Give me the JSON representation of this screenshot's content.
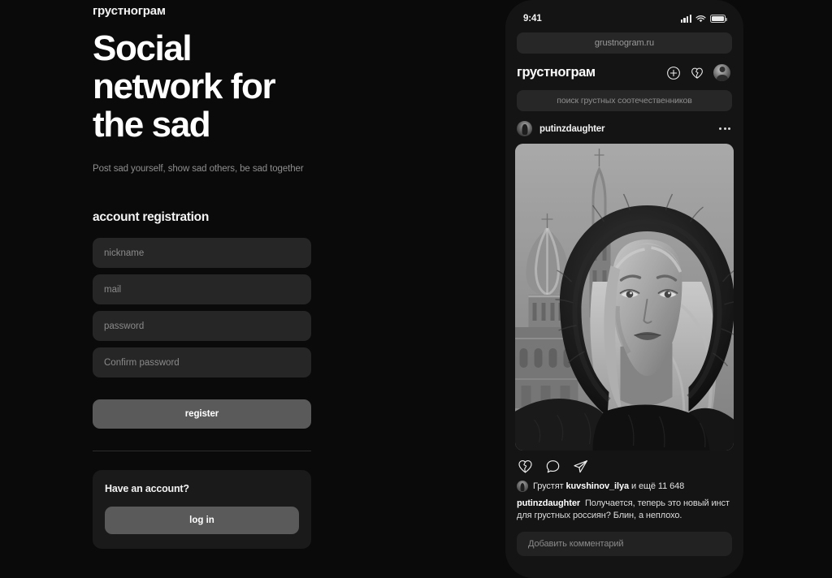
{
  "colors": {
    "page_bg": "#0a0a0a",
    "field_bg": "#262626",
    "button_bg": "#5a5a5a",
    "card_bg": "#1a1a1a",
    "phone_bg": "#141414",
    "text_primary": "#ffffff",
    "text_muted": "#8e8e8e"
  },
  "landing": {
    "brand": "грустнограм",
    "hero_title": "Social\nnetwork for\nthe sad",
    "hero_subtitle": "Post sad yourself, show sad others, be sad together",
    "form_title": "account registration",
    "fields": [
      {
        "name": "nickname",
        "placeholder": "nickname",
        "value": ""
      },
      {
        "name": "mail",
        "placeholder": "mail",
        "value": ""
      },
      {
        "name": "password",
        "placeholder": "password",
        "value": ""
      },
      {
        "name": "confirm_password",
        "placeholder": "Confirm password",
        "value": ""
      }
    ],
    "register_label": "register",
    "account_card": {
      "title": "Have an account?",
      "login_label": "log in"
    }
  },
  "phone": {
    "status_bar": {
      "time": "9:41",
      "icons": [
        "signal-icon",
        "wifi-icon",
        "battery-icon"
      ]
    },
    "browser": {
      "url": "grustnogram.ru"
    },
    "app_header": {
      "logo": "грустнограм",
      "icons": [
        "plus-circle-icon",
        "broken-heart-icon",
        "avatar"
      ]
    },
    "search": {
      "placeholder": "поиск грустных соотечественников"
    },
    "post": {
      "username": "putinzdaughter",
      "menu_icon": "more-options-icon",
      "photo_alt": "Black and white photo of a woman in a fur hood in front of Saint Basil's Cathedral",
      "actions": [
        "broken-heart-icon",
        "comment-icon",
        "share-icon"
      ],
      "likes": {
        "prefix": "Грустят",
        "user": "kuvshinov_ilya",
        "middle": " и ещё ",
        "count": "11 648"
      },
      "caption": {
        "author": "putinzdaughter",
        "text": "Получается, теперь это новый инст для грустных россиян? Блин, а неплохо."
      },
      "comment_placeholder": "Добавить комментарий"
    }
  }
}
